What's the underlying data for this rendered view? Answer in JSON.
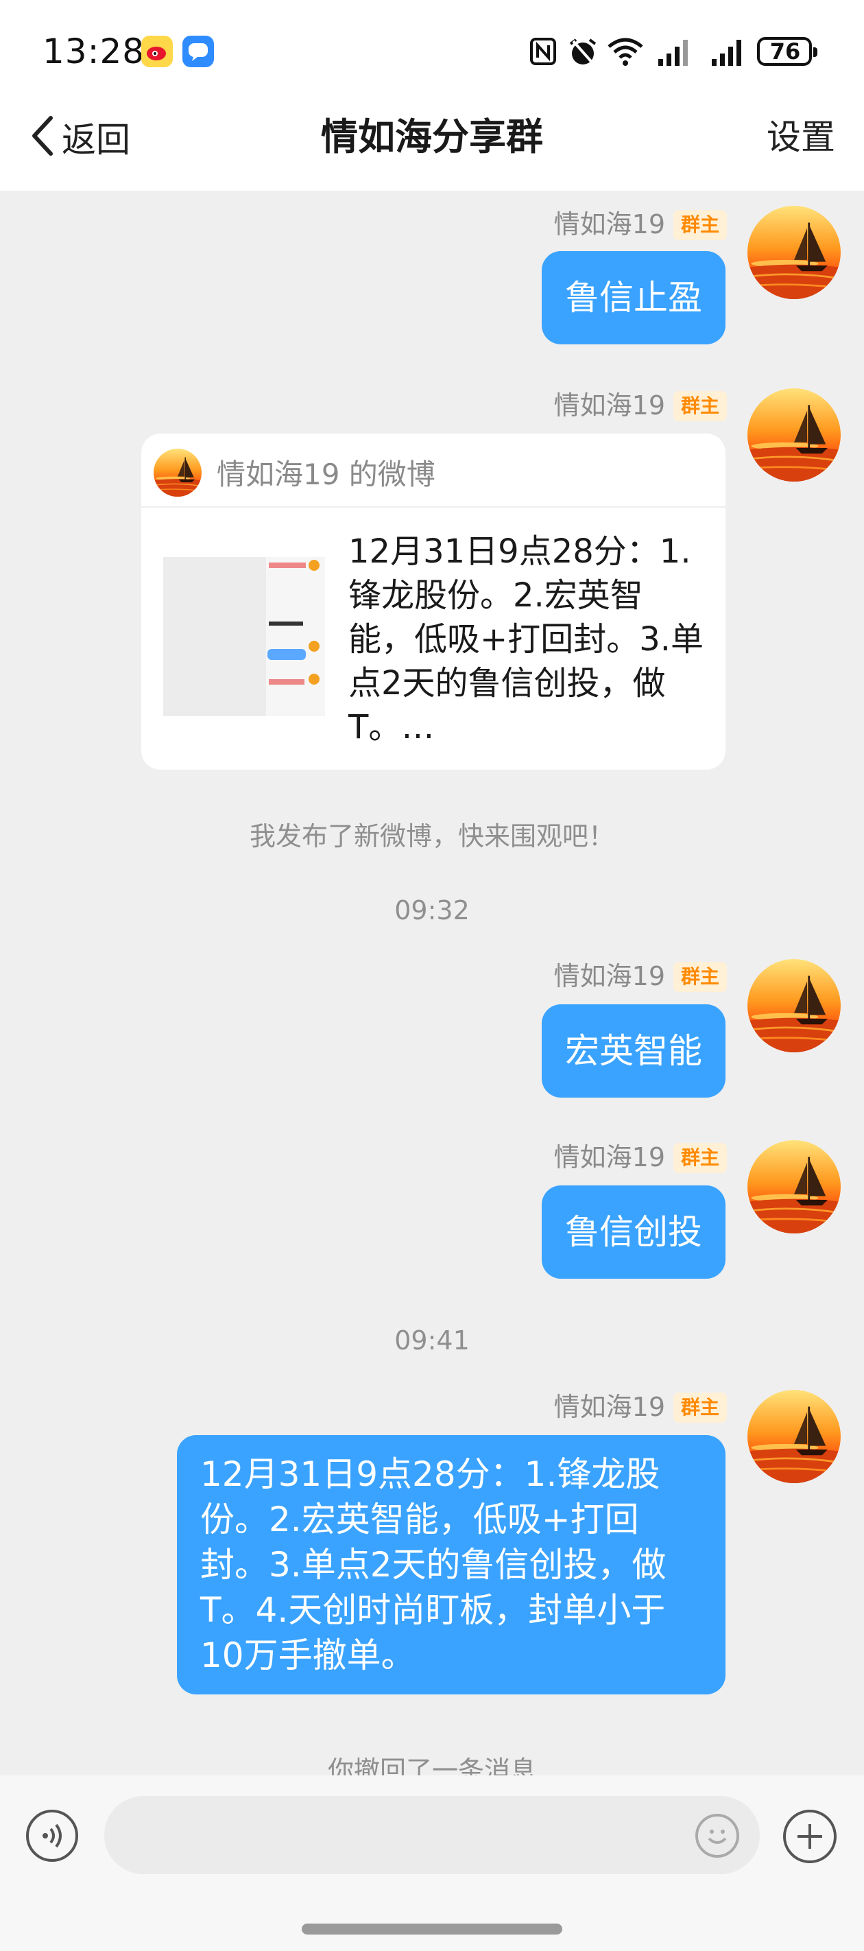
{
  "status_bar": {
    "time": "13:28",
    "battery": "76",
    "apps": [
      "weibo-icon",
      "message-icon"
    ],
    "system_icons": [
      "nfc-icon",
      "alarm-icon",
      "wifi-icon",
      "signal-icon",
      "signal-icon"
    ]
  },
  "header": {
    "back_label": "返回",
    "title": "情如海分享群",
    "settings_label": "设置"
  },
  "messages": [
    {
      "sender": "情如海19",
      "badge": "群主",
      "text": "鲁信止盈"
    },
    {
      "sender": "情如海19",
      "badge": "群主",
      "card_title": "情如海19 的微博",
      "card_text": "12月31日9点28分：1.锋龙股份。2.宏英智能，低吸+打回封。3.单点2天的鲁信创投，做T。…"
    },
    {
      "system": "我发布了新微博，快来围观吧！"
    },
    {
      "timestamp": "09:32"
    },
    {
      "sender": "情如海19",
      "badge": "群主",
      "text": "宏英智能"
    },
    {
      "sender": "情如海19",
      "badge": "群主",
      "text": "鲁信创投"
    },
    {
      "timestamp": "09:41"
    },
    {
      "sender": "情如海19",
      "badge": "群主",
      "text": "12月31日9点28分：1.锋龙股份。2.宏英智能，低吸+打回封。3.单点2天的鲁信创投，做T。4.天创时尚盯板，封单小于10万手撤单。"
    },
    {
      "system": "你撤回了一条消息"
    }
  ],
  "input": {
    "placeholder": ""
  },
  "colors": {
    "bubble": "#3aa3ff",
    "badge_text": "#ff8a00",
    "badge_bg": "#fff0d6",
    "background": "#efefef"
  }
}
